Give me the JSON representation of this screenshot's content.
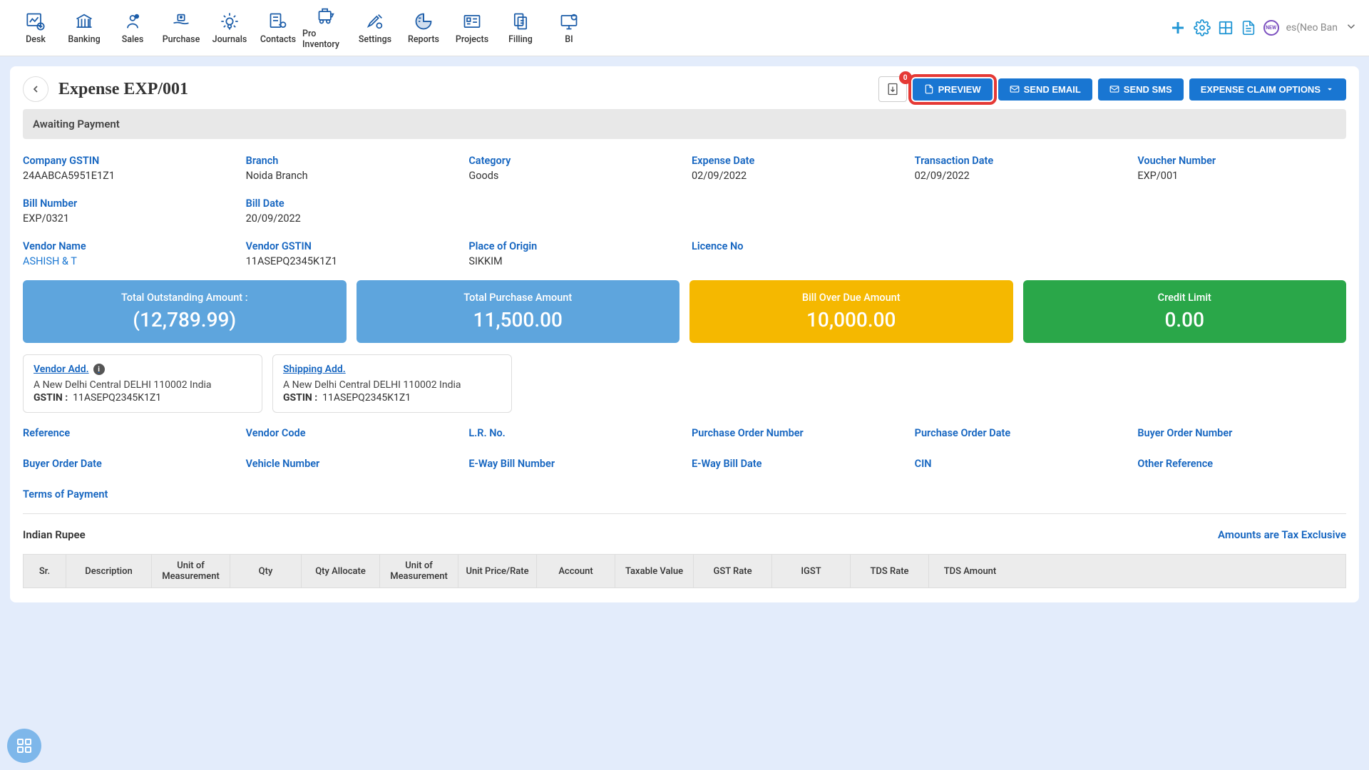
{
  "topnav": [
    {
      "label": "Desk"
    },
    {
      "label": "Banking"
    },
    {
      "label": "Sales"
    },
    {
      "label": "Purchase"
    },
    {
      "label": "Journals"
    },
    {
      "label": "Contacts"
    },
    {
      "label": "Pro Inventory"
    },
    {
      "label": "Settings"
    },
    {
      "label": "Reports"
    },
    {
      "label": "Projects"
    },
    {
      "label": "Filling"
    },
    {
      "label": "BI"
    }
  ],
  "user_label": "es(Neo Ban",
  "page_title": "Expense EXP/001",
  "attach_badge": "0",
  "buttons": {
    "preview": "PREVIEW",
    "send_email": "SEND EMAIL",
    "send_sms": "SEND SMS",
    "claim_options": "EXPENSE CLAIM OPTIONS"
  },
  "status": "Awaiting Payment",
  "details": [
    {
      "label": "Company GSTIN",
      "value": "24AABCA5951E1Z1"
    },
    {
      "label": "Branch",
      "value": "Noida Branch"
    },
    {
      "label": "Category",
      "value": "Goods"
    },
    {
      "label": "Expense Date",
      "value": "02/09/2022"
    },
    {
      "label": "Transaction Date",
      "value": "02/09/2022"
    },
    {
      "label": "Voucher Number",
      "value": "EXP/001"
    },
    {
      "label": "Bill Number",
      "value": "EXP/0321"
    },
    {
      "label": "Bill Date",
      "value": "20/09/2022"
    },
    {
      "label": "",
      "value": ""
    },
    {
      "label": "",
      "value": ""
    },
    {
      "label": "",
      "value": ""
    },
    {
      "label": "",
      "value": ""
    },
    {
      "label": "Vendor Name",
      "value": "ASHISH & T",
      "link": true
    },
    {
      "label": "Vendor GSTIN",
      "value": "11ASEPQ2345K1Z1"
    },
    {
      "label": "Place of Origin",
      "value": "SIKKIM"
    },
    {
      "label": "Licence No",
      "value": ""
    },
    {
      "label": "",
      "value": ""
    },
    {
      "label": "",
      "value": ""
    }
  ],
  "summary": [
    {
      "label": "Total Outstanding Amount :",
      "value": "(12,789.99)",
      "color": "#5ea5dd"
    },
    {
      "label": "Total Purchase Amount",
      "value": "11,500.00",
      "color": "#5ea5dd"
    },
    {
      "label": "Bill Over Due Amount",
      "value": "10,000.00",
      "color": "#f5b800"
    },
    {
      "label": "Credit Limit",
      "value": "0.00",
      "color": "#2aa749"
    }
  ],
  "addresses": [
    {
      "title": "Vendor Add.",
      "text": "A New Delhi Central DELHI 110002 India",
      "gstin": "11ASEPQ2345K1Z1",
      "info": true
    },
    {
      "title": "Shipping Add.",
      "text": "A New Delhi Central DELHI 110002 India",
      "gstin": "11ASEPQ2345K1Z1",
      "info": false
    }
  ],
  "gstin_label": "GSTIN :",
  "meta": [
    {
      "label": "Reference"
    },
    {
      "label": "Vendor Code"
    },
    {
      "label": "L.R. No."
    },
    {
      "label": "Purchase Order Number"
    },
    {
      "label": "Purchase Order Date"
    },
    {
      "label": "Buyer Order Number"
    },
    {
      "label": "Buyer Order Date"
    },
    {
      "label": "Vehicle Number"
    },
    {
      "label": "E-Way Bill Number"
    },
    {
      "label": "E-Way Bill Date"
    },
    {
      "label": "CIN"
    },
    {
      "label": "Other Reference"
    },
    {
      "label": "Terms of Payment"
    }
  ],
  "currency": "Indian Rupee",
  "tax_note": "Amounts are Tax Exclusive",
  "table_headers": [
    {
      "label": "Sr.",
      "w": "60"
    },
    {
      "label": "Description",
      "w": "120"
    },
    {
      "label": "Unit of Measurement",
      "w": "110"
    },
    {
      "label": "Qty",
      "w": "100"
    },
    {
      "label": "Qty Allocate",
      "w": "110"
    },
    {
      "label": "Unit of Measurement",
      "w": "110"
    },
    {
      "label": "Unit Price/Rate",
      "w": "110"
    },
    {
      "label": "Account",
      "w": "110"
    },
    {
      "label": "Taxable Value",
      "w": "110"
    },
    {
      "label": "GST Rate",
      "w": "110"
    },
    {
      "label": "IGST",
      "w": "110"
    },
    {
      "label": "TDS Rate",
      "w": "110"
    },
    {
      "label": "TDS Amount",
      "w": "115"
    }
  ]
}
